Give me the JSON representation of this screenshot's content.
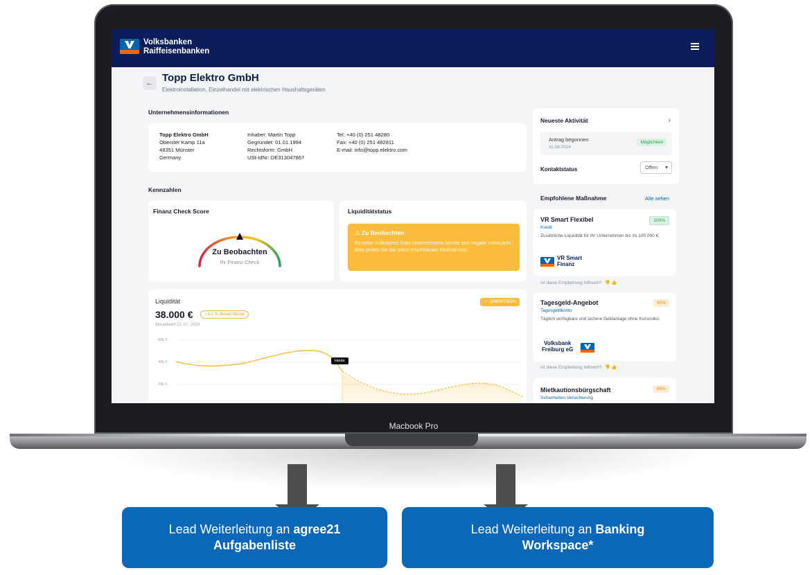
{
  "device": {
    "label": "Macbook Pro"
  },
  "app": {
    "brand_line1": "Volksbanken",
    "brand_line2": "Raiffeisenbanken"
  },
  "company": {
    "name": "Topp Elektro GmbH",
    "description": "Elektroinstallation, Einzelhandel mit elektrischen Haushaltsgeräten"
  },
  "sections": {
    "info": "Unternehmensinformationen",
    "kpis": "Kennzahlen"
  },
  "info": {
    "col1": [
      "Topp Elektro GmbH",
      "Oberster Kamp 11a",
      "48351 Münster",
      "Germany"
    ],
    "col2": [
      "Inhaber: Martin Topp",
      "Gegründet: 01.01.1994",
      "Rechtsform: GmbH",
      "USt-IdNr: DE313047867"
    ],
    "col3": [
      "Tel: +40 (0) 251 48280",
      "Fax: +40 (0) 251 482811",
      "E-mail: info@topp.elektro.com"
    ]
  },
  "score": {
    "title": "Finanz Check Score",
    "label": "Zu Beobachten",
    "sub": "Ihr Finanz Check"
  },
  "liquidity_status": {
    "title": "Liquiditätstatus",
    "warning_title": "Zu Beobachten",
    "warning_text": "Einzelne Indikatoren Ihres Unternehmens könnte sich negativ entwickeln. Bitte prüfen Sie die unten empfohlenen Maßnahmen."
  },
  "liquidity": {
    "label": "Liquidität",
    "value": "38.000 €",
    "change": "↓ 5.2 % diesen Monat",
    "updated": "Aktualisiert 22. 07. 2024",
    "badge": "UNKRITISCH",
    "today": "Heute",
    "ticks": [
      "60k €",
      "40k €",
      "20k €"
    ]
  },
  "activity": {
    "title": "Neueste Aktivität",
    "item": "Antrag begonnen",
    "date": "11.08.2024",
    "status": "Möglichkeit",
    "contact_label": "Kontaktstatus",
    "contact_value": "Offen"
  },
  "recommendations": {
    "title": "Empfohlene Maßnahme",
    "see_all": "Alle sehen",
    "helpful": "Ist diese Empfehlung hilfreich?",
    "items": [
      {
        "title": "VR Smart Flexibel",
        "category": "Kredit",
        "desc": "Zusätzliche Liquidität für Ihr Unternehmen bis zu 100.000 €.",
        "pct": "100%",
        "logo_text1": "VR Smart",
        "logo_text2": "Finanz"
      },
      {
        "title": "Tagesgeld-Angebot",
        "category": "Tagesgeldkonto",
        "desc": "Täglich verfügbare und sichere Geldanlage ohne Kursrisiko.",
        "pct": "80%",
        "logo_text1": "Volksbank",
        "logo_text2": "Freiburg eG"
      },
      {
        "title": "Mietkautionsbürgschaft",
        "category": "Sicherheiten Versicherung",
        "pct": "80%"
      }
    ]
  },
  "leads": [
    {
      "prefix": "Lead Weiterleitung an ",
      "bold1": "agree21",
      "bold2": "Aufgabenliste"
    },
    {
      "prefix": "Lead Weiterleitung an ",
      "bold1": "Banking",
      "bold2": "Workspace*"
    }
  ]
}
